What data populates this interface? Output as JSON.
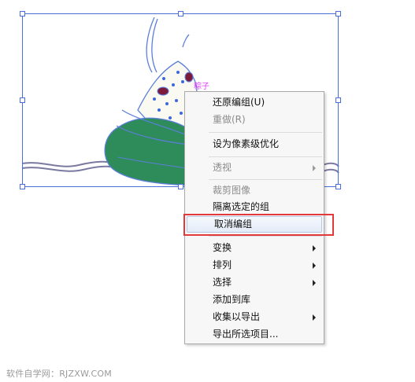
{
  "artboard": {
    "object_label": "粽子"
  },
  "context_menu": {
    "items": [
      {
        "label": "还原编组(U)",
        "disabled": false,
        "submenu": false
      },
      {
        "label": "重做(R)",
        "disabled": true,
        "submenu": false
      },
      {
        "label": "设为像素级优化",
        "disabled": false,
        "submenu": false
      },
      {
        "label": "透视",
        "disabled": true,
        "submenu": true
      },
      {
        "label": "裁剪图像",
        "disabled": true,
        "submenu": false
      },
      {
        "label": "隔离选定的组",
        "disabled": false,
        "submenu": false
      },
      {
        "label": "取消编组",
        "disabled": false,
        "submenu": false,
        "highlighted": true
      },
      {
        "label": "变换",
        "disabled": false,
        "submenu": true
      },
      {
        "label": "排列",
        "disabled": false,
        "submenu": true
      },
      {
        "label": "选择",
        "disabled": false,
        "submenu": true
      },
      {
        "label": "添加到库",
        "disabled": false,
        "submenu": false
      },
      {
        "label": "收集以导出",
        "disabled": false,
        "submenu": true
      },
      {
        "label": "导出所选项目...",
        "disabled": false,
        "submenu": false
      }
    ]
  },
  "watermark": "软件自学网：RJZXW.COM",
  "colors": {
    "selection": "#4a6fd8",
    "leaf": "#2e8b5a",
    "highlight_frame": "#e23a3a",
    "label": "#e040fb"
  }
}
